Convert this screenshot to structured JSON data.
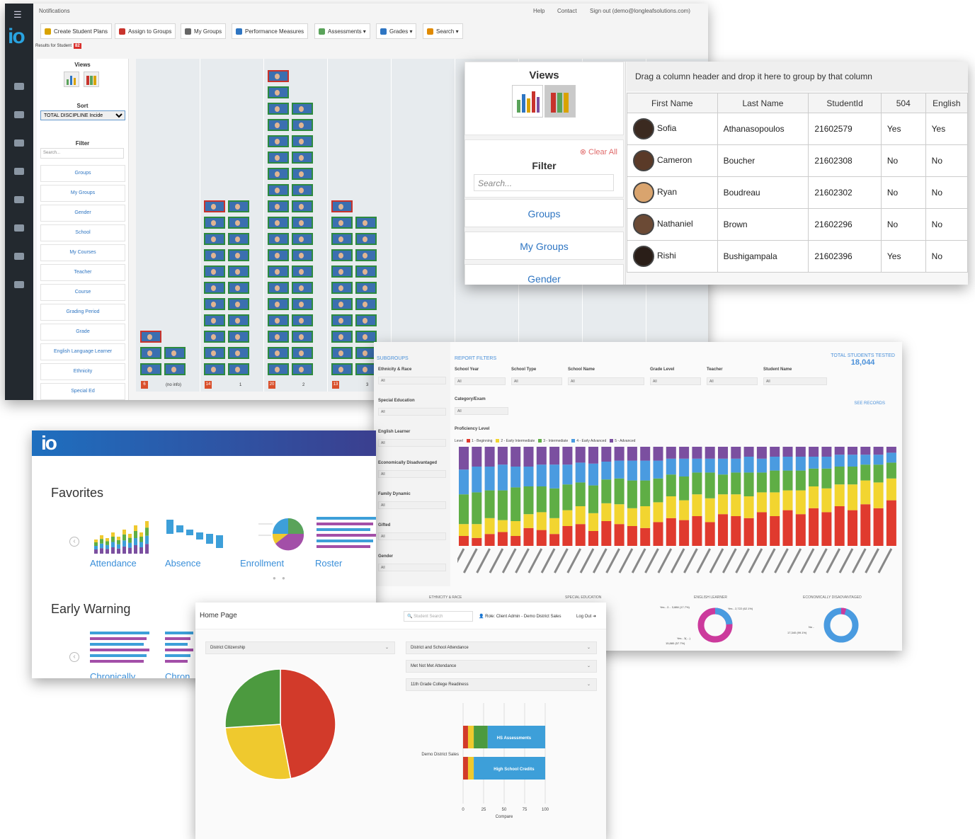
{
  "p1": {
    "topbar": {
      "notifications": "Notifications",
      "help": "Help",
      "contact": "Contact",
      "signout": "Sign out (demo@longleafsolutions.com)"
    },
    "toolbar": [
      {
        "label": "Create Student Plans",
        "color": "#d9a300"
      },
      {
        "label": "Assign to Groups",
        "color": "#c8332c"
      },
      {
        "label": "My Groups",
        "color": "#666666"
      },
      {
        "label": "Performance Measures",
        "color": "#2e75c2"
      },
      {
        "label": "Assessments ▾",
        "color": "#5aa35a"
      },
      {
        "label": "Grades ▾",
        "color": "#2e75c2"
      },
      {
        "label": "Search ▾",
        "color": "#e08a00"
      }
    ],
    "results_label": "Results for Student",
    "results_count": "82",
    "side": {
      "views": "Views",
      "sort": "Sort",
      "sort_value": "TOTAL DISCIPLINE Incide",
      "filter": "Filter",
      "search_placeholder": "Search...",
      "items": [
        "Groups",
        "My Groups",
        "Gender",
        "School",
        "My Courses",
        "Teacher",
        "Course",
        "Grading Period",
        "Grade",
        "English Language Learner",
        "Ethnicity",
        "Special Ed"
      ]
    },
    "chart_counts": [
      "6",
      "14",
      "20",
      "13"
    ],
    "x_labels": [
      "(no info)",
      "1",
      "2",
      "3"
    ]
  },
  "p2": {
    "views": "Views",
    "clear_all": "Clear All",
    "filter": "Filter",
    "search_placeholder": "Search...",
    "filter_buttons": [
      "Groups",
      "My Groups",
      "Gender"
    ],
    "group_hint": "Drag a column header and drop it here to group by that column",
    "columns": [
      "First Name",
      "Last Name",
      "StudentId",
      "504",
      "English"
    ],
    "rows": [
      {
        "first": "Sofia",
        "last": "Athanasopoulos",
        "id": "21602579",
        "s504": "Yes",
        "english": "Yes"
      },
      {
        "first": "Cameron",
        "last": "Boucher",
        "id": "21602308",
        "s504": "No",
        "english": "No"
      },
      {
        "first": "Ryan",
        "last": "Boudreau",
        "id": "21602302",
        "s504": "No",
        "english": "No"
      },
      {
        "first": "Nathaniel",
        "last": "Brown",
        "id": "21602296",
        "s504": "No",
        "english": "No"
      },
      {
        "first": "Rishi",
        "last": "Bushigampala",
        "id": "21602396",
        "s504": "Yes",
        "english": "No"
      }
    ]
  },
  "p3": {
    "subgroups": "SUBGROUPS",
    "report_filters": "REPORT FILTERS",
    "total_label": "TOTAL STUDENTS TESTED",
    "total_value": "18,044",
    "see_records": "SEE RECORDS",
    "sub_labels": [
      "Ethnicity & Race",
      "Special Education",
      "English Learner",
      "Economically Disadvantaged",
      "Family Dynamic",
      "Gifted",
      "Gender"
    ],
    "filter_labels": [
      "School Year",
      "School Type",
      "School Name",
      "Grade Level",
      "Teacher",
      "Student Name"
    ],
    "category_label": "Category/Exam",
    "proficiency_label": "Proficiency Level",
    "all": "All",
    "legend_title": "Level",
    "bottom_labels": [
      "ETHNICITY & RACE",
      "SPECIAL EDUCATION",
      "ENGLISH LEARNER",
      "ECONOMICALLY DISADVANTAGED"
    ],
    "chart_data": {
      "type": "bar",
      "stacked": true,
      "series": [
        {
          "name": "1 - Beginning",
          "color": "#e03a2e"
        },
        {
          "name": "2 - Early Intermediate",
          "color": "#f2d530"
        },
        {
          "name": "3 - Intermediate",
          "color": "#5fae45"
        },
        {
          "name": "4 - Early Advanced",
          "color": "#4a9be0"
        },
        {
          "name": "5 - Advanced",
          "color": "#7b4fa0"
        }
      ],
      "values": [
        [
          10,
          12,
          30,
          25,
          23
        ],
        [
          8,
          14,
          32,
          26,
          20
        ],
        [
          12,
          16,
          28,
          24,
          20
        ],
        [
          14,
          12,
          30,
          26,
          18
        ],
        [
          10,
          15,
          34,
          21,
          20
        ],
        [
          18,
          14,
          28,
          20,
          20
        ],
        [
          16,
          18,
          26,
          22,
          18
        ],
        [
          12,
          16,
          30,
          24,
          18
        ],
        [
          20,
          16,
          26,
          20,
          18
        ],
        [
          22,
          18,
          24,
          20,
          16
        ],
        [
          15,
          18,
          28,
          22,
          17
        ],
        [
          25,
          18,
          24,
          18,
          15
        ],
        [
          22,
          20,
          26,
          18,
          14
        ],
        [
          20,
          18,
          28,
          20,
          14
        ],
        [
          18,
          22,
          26,
          20,
          14
        ],
        [
          24,
          20,
          24,
          18,
          14
        ],
        [
          28,
          22,
          22,
          16,
          12
        ],
        [
          26,
          20,
          24,
          18,
          12
        ],
        [
          30,
          22,
          22,
          14,
          12
        ],
        [
          24,
          24,
          26,
          14,
          12
        ],
        [
          32,
          20,
          20,
          16,
          12
        ],
        [
          30,
          22,
          22,
          14,
          12
        ],
        [
          28,
          22,
          24,
          16,
          10
        ],
        [
          34,
          20,
          20,
          14,
          12
        ],
        [
          30,
          24,
          22,
          14,
          10
        ],
        [
          36,
          20,
          20,
          14,
          10
        ],
        [
          32,
          24,
          20,
          14,
          10
        ],
        [
          38,
          22,
          18,
          12,
          10
        ],
        [
          34,
          24,
          20,
          12,
          10
        ],
        [
          40,
          22,
          18,
          12,
          8
        ],
        [
          36,
          26,
          18,
          12,
          8
        ],
        [
          42,
          24,
          16,
          10,
          8
        ],
        [
          38,
          26,
          18,
          10,
          8
        ],
        [
          46,
          22,
          16,
          10,
          6
        ]
      ]
    },
    "donut_labels": [
      "Yes - 2... 3,886 (17.7%)",
      "Yes - 2,722 (62.1%)",
      "Yes - 3(…)",
      "15,880 (57.7%)",
      "No -",
      "17,340 (99.1%)"
    ]
  },
  "p4": {
    "favorites": "Favorites",
    "early_warning": "Early Warning",
    "items": [
      "Attendance",
      "Absence",
      "Enrollment",
      "Roster"
    ],
    "early_items": [
      "Chronically",
      "Chron"
    ]
  },
  "p5": {
    "title": "Home Page",
    "search_placeholder": "Student Search",
    "role": "Role: Client Admin - Demo District Sales",
    "logout": "Log Out",
    "card_left": "District Citizenship",
    "cards_right": [
      "District and School Attendance",
      "Met Not Met Attendance",
      "11th Grade College Readiness"
    ],
    "pie": {
      "type": "pie",
      "slices": [
        {
          "value": 47,
          "color": "#d23a2a"
        },
        {
          "value": 27,
          "color": "#efc92e"
        },
        {
          "value": 26,
          "color": "#4c9a3f"
        }
      ]
    },
    "bar_chart": {
      "type": "bar",
      "category_label": "Demo District Sales",
      "bars": [
        {
          "name": "HS Assessments",
          "segments": [
            6,
            7,
            17,
            70
          ]
        },
        {
          "name": "High School Credits",
          "segments": [
            6,
            7,
            0,
            87
          ]
        }
      ],
      "colors": [
        "#d23a2a",
        "#efc92e",
        "#4c9a3f",
        "#3d9fd9"
      ],
      "ticks": [
        "0",
        "25",
        "50",
        "75",
        "100"
      ],
      "xlabel": "Compare"
    }
  }
}
